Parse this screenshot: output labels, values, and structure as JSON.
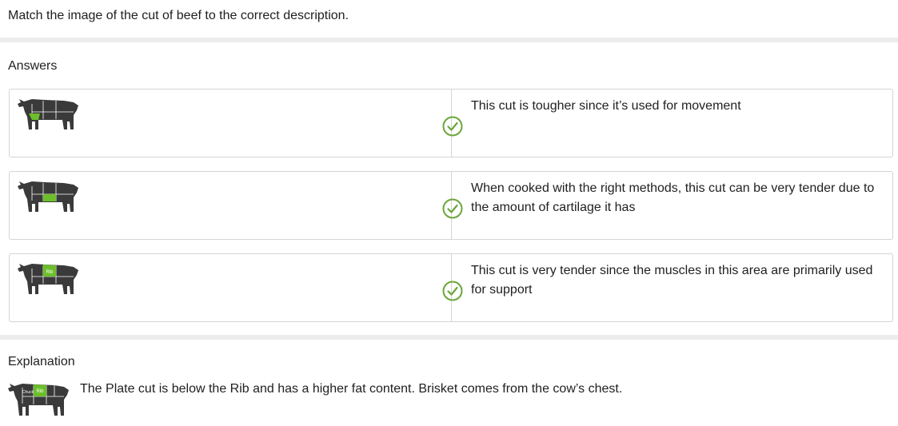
{
  "question": "Match the image of the cut of beef to the correct description.",
  "answers_title": "Answers",
  "answers": [
    {
      "image_label": "",
      "highlighted_cut": "shank",
      "description": "This cut is tougher since it’s used for movement",
      "status_icon": "check-circle-icon"
    },
    {
      "image_label": "",
      "highlighted_cut": "plate",
      "description": "When cooked with the right methods, this cut can be very tender due to the amount of cartilage it has",
      "status_icon": "check-circle-icon"
    },
    {
      "image_label": "Rib",
      "highlighted_cut": "rib",
      "description": "This cut is very tender since the muscles in this area are primarily used for support",
      "status_icon": "check-circle-icon"
    }
  ],
  "explanation_title": "Explanation",
  "explanation_image_labels": [
    "Chuck",
    "Rib"
  ],
  "explanation_text": "The Plate cut is below the Rib and has a higher fat content. Brisket comes from the cow’s chest.",
  "colors": {
    "cow": "#3a3a3a",
    "highlight": "#6cbf2a",
    "check": "#6aa63a",
    "border": "#d4d4d4"
  }
}
